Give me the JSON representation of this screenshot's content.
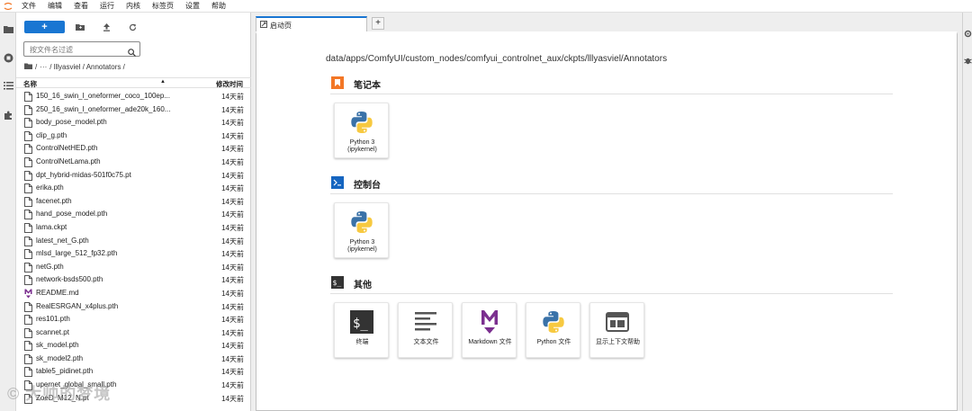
{
  "menu": [
    "文件",
    "编辑",
    "查看",
    "运行",
    "内核",
    "标签页",
    "设置",
    "帮助"
  ],
  "toolbar": {
    "new_label": "+"
  },
  "search": {
    "placeholder": "按文件名过滤"
  },
  "breadcrumb": {
    "ellipsis": "···",
    "path": "/ lllyasviel / Annotators /"
  },
  "list_header": {
    "name": "名称",
    "modified": "修改时间"
  },
  "files": [
    {
      "name": "150_16_swin_l_oneformer_coco_100ep...",
      "modified": "14天前",
      "kind": "file"
    },
    {
      "name": "250_16_swin_l_oneformer_ade20k_160...",
      "modified": "14天前",
      "kind": "file"
    },
    {
      "name": "body_pose_model.pth",
      "modified": "14天前",
      "kind": "file"
    },
    {
      "name": "clip_g.pth",
      "modified": "14天前",
      "kind": "file"
    },
    {
      "name": "ControlNetHED.pth",
      "modified": "14天前",
      "kind": "file"
    },
    {
      "name": "ControlNetLama.pth",
      "modified": "14天前",
      "kind": "file"
    },
    {
      "name": "dpt_hybrid-midas-501f0c75.pt",
      "modified": "14天前",
      "kind": "file"
    },
    {
      "name": "erika.pth",
      "modified": "14天前",
      "kind": "file"
    },
    {
      "name": "facenet.pth",
      "modified": "14天前",
      "kind": "file"
    },
    {
      "name": "hand_pose_model.pth",
      "modified": "14天前",
      "kind": "file"
    },
    {
      "name": "lama.ckpt",
      "modified": "14天前",
      "kind": "file"
    },
    {
      "name": "latest_net_G.pth",
      "modified": "14天前",
      "kind": "file"
    },
    {
      "name": "mlsd_large_512_fp32.pth",
      "modified": "14天前",
      "kind": "file"
    },
    {
      "name": "netG.pth",
      "modified": "14天前",
      "kind": "file"
    },
    {
      "name": "network-bsds500.pth",
      "modified": "14天前",
      "kind": "file"
    },
    {
      "name": "README.md",
      "modified": "14天前",
      "kind": "markdown"
    },
    {
      "name": "RealESRGAN_x4plus.pth",
      "modified": "14天前",
      "kind": "file"
    },
    {
      "name": "res101.pth",
      "modified": "14天前",
      "kind": "file"
    },
    {
      "name": "scannet.pt",
      "modified": "14天前",
      "kind": "file"
    },
    {
      "name": "sk_model.pth",
      "modified": "14天前",
      "kind": "file"
    },
    {
      "name": "sk_model2.pth",
      "modified": "14天前",
      "kind": "file"
    },
    {
      "name": "table5_pidinet.pth",
      "modified": "14天前",
      "kind": "file"
    },
    {
      "name": "upernet_global_small.pth",
      "modified": "14天前",
      "kind": "file"
    },
    {
      "name": "ZoeD_M12_N.pt",
      "modified": "14天前",
      "kind": "file"
    }
  ],
  "tab": {
    "label": "启动页",
    "add_label": "+"
  },
  "launcher": {
    "cwd": "data/apps/ComfyUI/custom_nodes/comfyui_controlnet_aux/ckpts/lllyasviel/Annotators",
    "sections": [
      {
        "title": "笔记本",
        "icon": "notebook-icon",
        "cards": [
          {
            "label": "Python 3\n(ipykernel)",
            "icon": "python-icon"
          }
        ]
      },
      {
        "title": "控制台",
        "icon": "console-icon",
        "cards": [
          {
            "label": "Python 3\n(ipykernel)",
            "icon": "python-icon"
          }
        ]
      },
      {
        "title": "其他",
        "icon": "other-icon",
        "cards": [
          {
            "label": "终端",
            "icon": "terminal-icon"
          },
          {
            "label": "文本文件",
            "icon": "text-file-icon"
          },
          {
            "label": "Markdown 文件",
            "icon": "markdown-icon"
          },
          {
            "label": "Python 文件",
            "icon": "python-icon"
          },
          {
            "label": "显示上下文帮助",
            "icon": "context-help-icon"
          }
        ]
      }
    ]
  },
  "watermark": "© 大帅的梦境",
  "colors": {
    "accent": "#1976d2",
    "notebook": "#f37726",
    "console": "#0d47a1",
    "markdown": "#7b2f8f"
  }
}
